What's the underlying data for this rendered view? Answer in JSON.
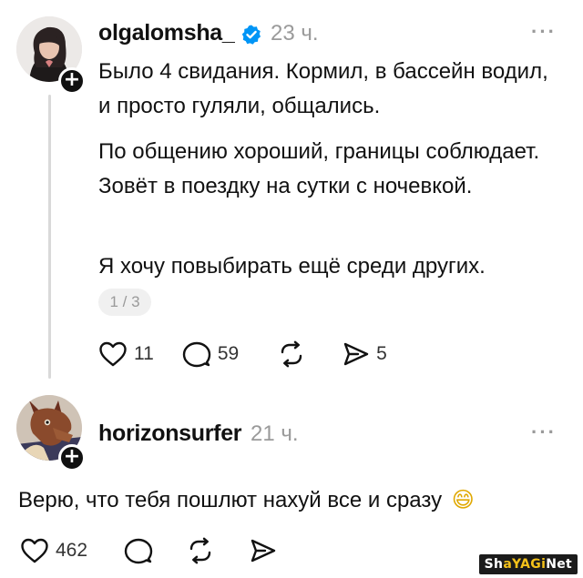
{
  "post1": {
    "username": "olgalomsha_",
    "time": "23 ч.",
    "paragraphs": [
      "Было 4 свидания. Кормил, в бассейн водил, и просто гуляли, общались.",
      "По общению хороший, границы соблюдает. Зовёт в поездку на сутки с ночевкой.",
      "Я хочу повыбирать ещё среди других."
    ],
    "pager": "1 / 3",
    "likes": "11",
    "replies": "59",
    "shares": "5"
  },
  "post2": {
    "username": "horizonsurfer",
    "time": "21 ч.",
    "text": "Верю, что тебя пошлют нахуй все и сразу",
    "emoji": "😄",
    "likes": "462"
  },
  "watermark": {
    "prefix": "Sh",
    "accent": "aYAGi",
    "suffix": "Net"
  },
  "colors": {
    "verified": "#0095f6",
    "muted": "#9a9a9a",
    "thread": "#d9d9d9"
  }
}
